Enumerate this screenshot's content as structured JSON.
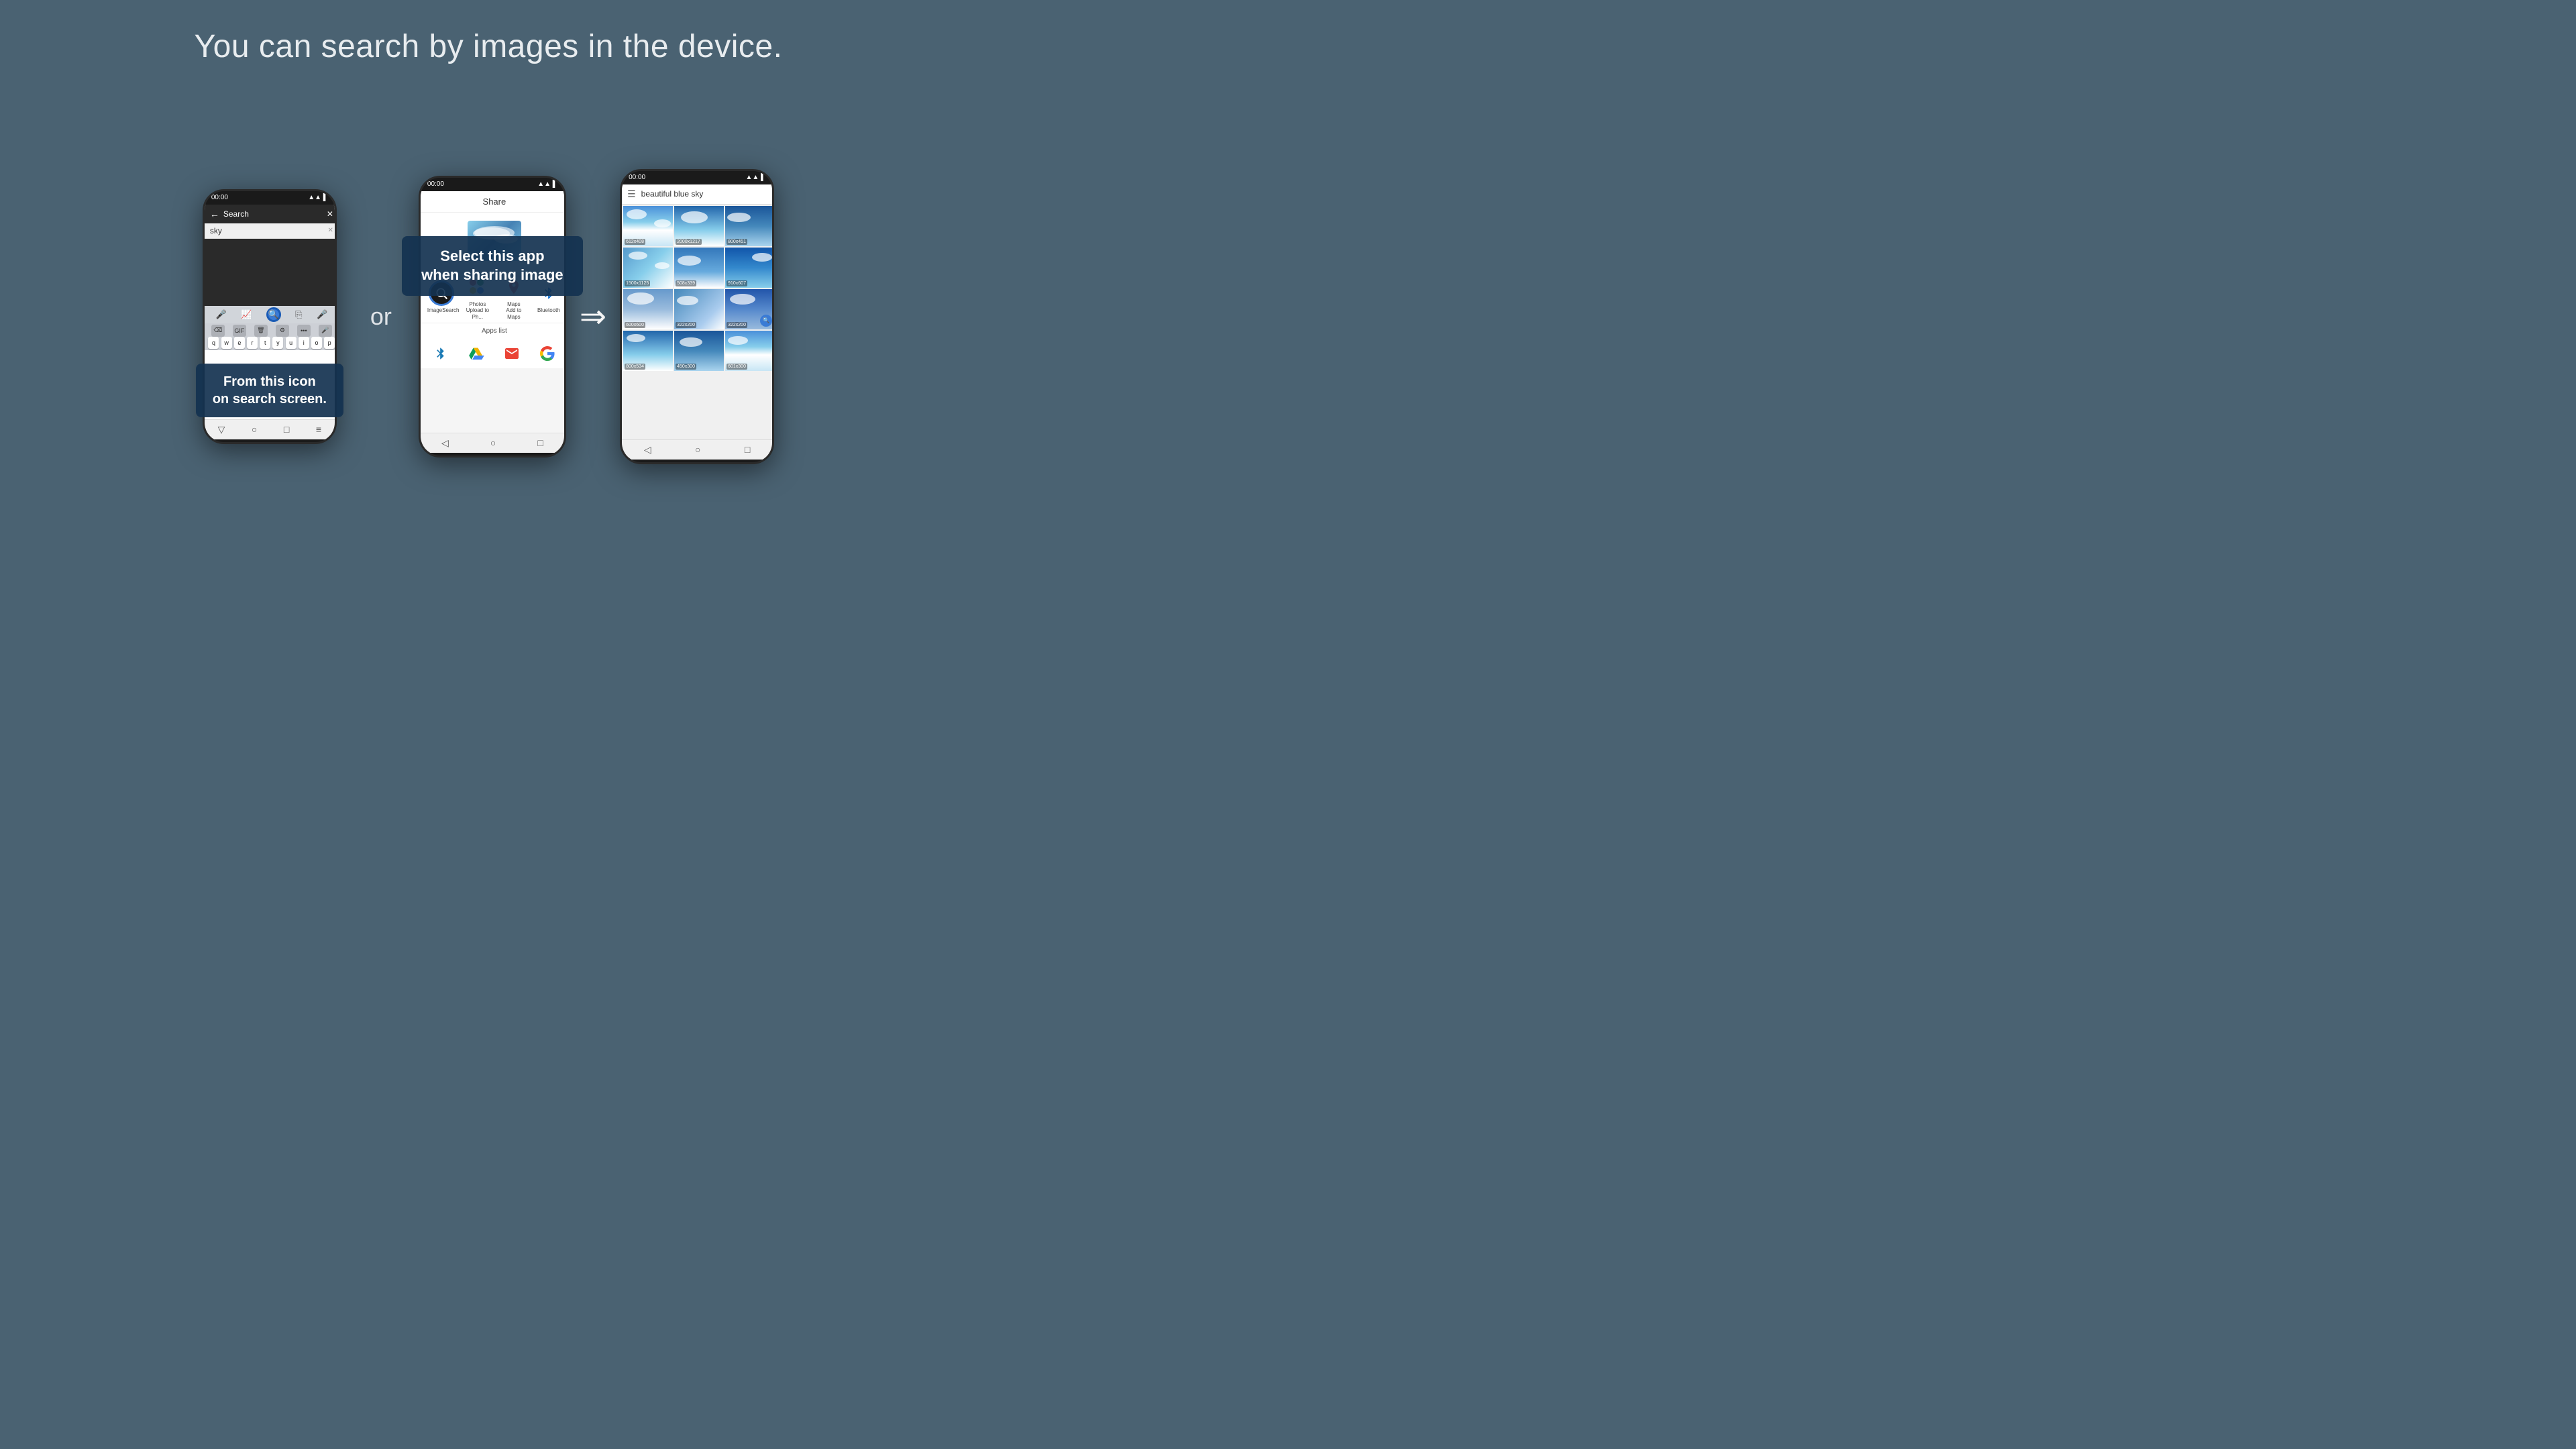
{
  "page": {
    "title": "You can search by images in the device.",
    "background_color": "#4a6272"
  },
  "phone1": {
    "status_bar": "00:00",
    "search_placeholder": "Search",
    "search_typed": "sky",
    "tooltip": {
      "line1": "From this icon",
      "line2": "on search screen."
    },
    "keyboard": {
      "row1": [
        "q",
        "w",
        "e",
        "r",
        "t",
        "y",
        "u",
        "i",
        "o",
        "p"
      ],
      "toolbar_icons": [
        "mic",
        "trend",
        "image-search",
        "copy"
      ]
    }
  },
  "or_text": "or",
  "phone2": {
    "status_bar": "00:00",
    "share_title": "Share",
    "apps": [
      {
        "name": "ImageSearch",
        "label": "ImageSearch"
      },
      {
        "name": "Photos",
        "label": "Photos\nUpload to Ph..."
      },
      {
        "name": "Maps",
        "label": "Maps\nAdd to Maps"
      },
      {
        "name": "Bluetooth",
        "label": "Bluetooth"
      }
    ],
    "apps_list_label": "Apps list",
    "tooltip": {
      "line1": "Select this app",
      "line2": "when sharing image"
    }
  },
  "arrow": "⇒",
  "phone3": {
    "status_bar": "00:00",
    "search_title": "beautiful blue sky",
    "results": [
      {
        "size": "612x408"
      },
      {
        "size": "2000x1217"
      },
      {
        "size": "800x451"
      },
      {
        "size": "1500x1125"
      },
      {
        "size": "508x339"
      },
      {
        "size": "910x607"
      },
      {
        "size": "600x600"
      },
      {
        "size": "322x200"
      },
      {
        "size": "322x200"
      },
      {
        "size": "800x534"
      },
      {
        "size": "450x300"
      },
      {
        "size": "601x300"
      }
    ]
  }
}
